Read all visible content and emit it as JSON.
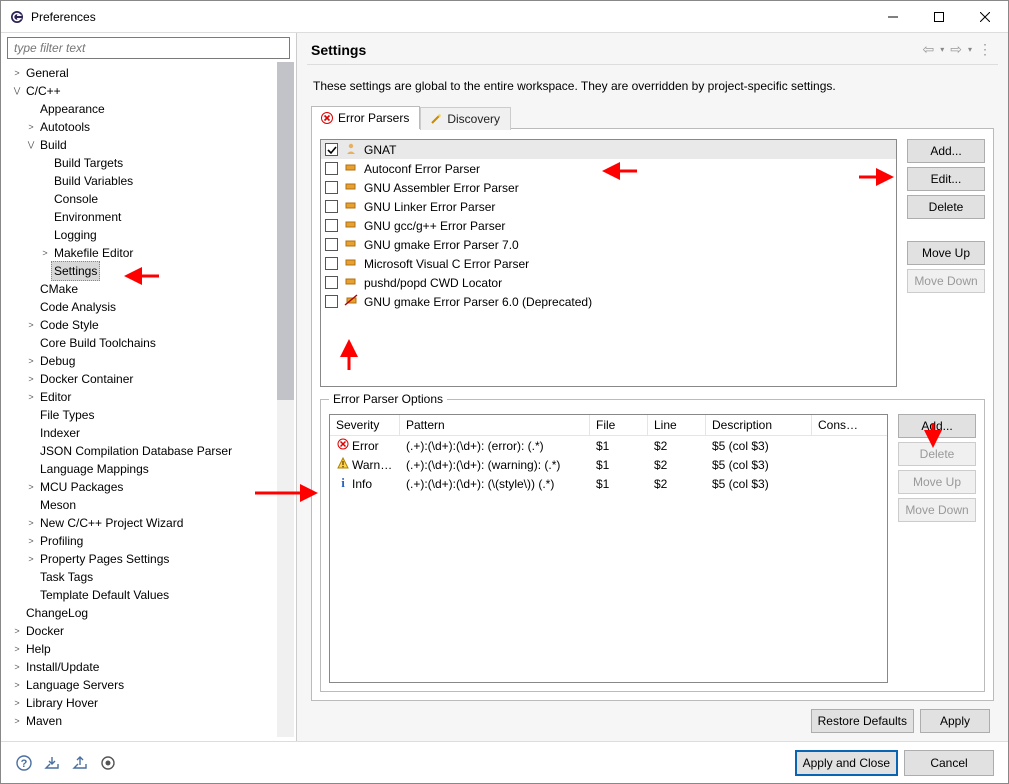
{
  "window": {
    "title": "Preferences"
  },
  "filter": {
    "placeholder": "type filter text"
  },
  "tree": [
    {
      "lvl": 0,
      "tw": ">",
      "label": "General"
    },
    {
      "lvl": 0,
      "tw": "v",
      "label": "C/C++"
    },
    {
      "lvl": 1,
      "tw": "",
      "label": "Appearance"
    },
    {
      "lvl": 1,
      "tw": ">",
      "label": "Autotools"
    },
    {
      "lvl": 1,
      "tw": "v",
      "label": "Build"
    },
    {
      "lvl": 2,
      "tw": "",
      "label": "Build Targets"
    },
    {
      "lvl": 2,
      "tw": "",
      "label": "Build Variables"
    },
    {
      "lvl": 2,
      "tw": "",
      "label": "Console"
    },
    {
      "lvl": 2,
      "tw": "",
      "label": "Environment"
    },
    {
      "lvl": 2,
      "tw": "",
      "label": "Logging"
    },
    {
      "lvl": 2,
      "tw": ">",
      "label": "Makefile Editor"
    },
    {
      "lvl": 2,
      "tw": "",
      "label": "Settings",
      "selected": true
    },
    {
      "lvl": 1,
      "tw": "",
      "label": "CMake"
    },
    {
      "lvl": 1,
      "tw": "",
      "label": "Code Analysis"
    },
    {
      "lvl": 1,
      "tw": ">",
      "label": "Code Style"
    },
    {
      "lvl": 1,
      "tw": "",
      "label": "Core Build Toolchains"
    },
    {
      "lvl": 1,
      "tw": ">",
      "label": "Debug"
    },
    {
      "lvl": 1,
      "tw": ">",
      "label": "Docker Container"
    },
    {
      "lvl": 1,
      "tw": ">",
      "label": "Editor"
    },
    {
      "lvl": 1,
      "tw": "",
      "label": "File Types"
    },
    {
      "lvl": 1,
      "tw": "",
      "label": "Indexer"
    },
    {
      "lvl": 1,
      "tw": "",
      "label": "JSON Compilation Database Parser"
    },
    {
      "lvl": 1,
      "tw": "",
      "label": "Language Mappings"
    },
    {
      "lvl": 1,
      "tw": ">",
      "label": "MCU Packages"
    },
    {
      "lvl": 1,
      "tw": "",
      "label": "Meson"
    },
    {
      "lvl": 1,
      "tw": ">",
      "label": "New C/C++ Project Wizard"
    },
    {
      "lvl": 1,
      "tw": ">",
      "label": "Profiling"
    },
    {
      "lvl": 1,
      "tw": ">",
      "label": "Property Pages Settings"
    },
    {
      "lvl": 1,
      "tw": "",
      "label": "Task Tags"
    },
    {
      "lvl": 1,
      "tw": "",
      "label": "Template Default Values"
    },
    {
      "lvl": 0,
      "tw": "",
      "label": "ChangeLog"
    },
    {
      "lvl": 0,
      "tw": ">",
      "label": "Docker"
    },
    {
      "lvl": 0,
      "tw": ">",
      "label": "Help"
    },
    {
      "lvl": 0,
      "tw": ">",
      "label": "Install/Update"
    },
    {
      "lvl": 0,
      "tw": ">",
      "label": "Language Servers"
    },
    {
      "lvl": 0,
      "tw": ">",
      "label": "Library Hover"
    },
    {
      "lvl": 0,
      "tw": ">",
      "label": "Maven"
    }
  ],
  "page": {
    "heading": "Settings",
    "description": "These settings are global to the entire workspace.  They are overridden by project-specific settings.",
    "tab1": "Error Parsers",
    "tab2": "Discovery"
  },
  "parsers": [
    {
      "checked": true,
      "icon": "person",
      "label": "GNAT",
      "sel": true
    },
    {
      "checked": false,
      "icon": "brick",
      "label": "Autoconf Error Parser"
    },
    {
      "checked": false,
      "icon": "brick",
      "label": "GNU Assembler Error Parser"
    },
    {
      "checked": false,
      "icon": "brick",
      "label": "GNU Linker Error Parser"
    },
    {
      "checked": false,
      "icon": "brick",
      "label": "GNU gcc/g++ Error Parser"
    },
    {
      "checked": false,
      "icon": "brick",
      "label": "GNU gmake Error Parser 7.0"
    },
    {
      "checked": false,
      "icon": "brick",
      "label": "Microsoft Visual C Error Parser"
    },
    {
      "checked": false,
      "icon": "brick",
      "label": "pushd/popd CWD Locator"
    },
    {
      "checked": false,
      "icon": "brick-dep",
      "label": "GNU gmake Error Parser 6.0 (Deprecated)"
    }
  ],
  "parserButtons": {
    "add": "Add...",
    "edit": "Edit...",
    "delete": "Delete",
    "moveUp": "Move Up",
    "moveDown": "Move Down"
  },
  "optionsGroup": "Error Parser Options",
  "tableHeaders": {
    "sev": "Severity",
    "pat": "Pattern",
    "file": "File",
    "line": "Line",
    "desc": "Description",
    "cons": "Consu..."
  },
  "patterns": [
    {
      "sev": "Error",
      "icon": "err",
      "pat": "(.+):(\\d+):(\\d+): (error): (.*)",
      "file": "$1",
      "line": "$2",
      "desc": "$5 (col $3)"
    },
    {
      "sev": "Warning",
      "icon": "warn",
      "pat": "(.+):(\\d+):(\\d+): (warning): (.*)",
      "file": "$1",
      "line": "$2",
      "desc": "$5 (col $3)"
    },
    {
      "sev": "Info",
      "icon": "info",
      "pat": "(.+):(\\d+):(\\d+): (\\(style\\)) (.*)",
      "file": "$1",
      "line": "$2",
      "desc": "$5 (col $3)"
    }
  ],
  "optionButtons": {
    "add": "Add...",
    "delete": "Delete",
    "moveUp": "Move Up",
    "moveDown": "Move Down"
  },
  "bottom": {
    "restore": "Restore Defaults",
    "apply": "Apply"
  },
  "footer": {
    "applyClose": "Apply and Close",
    "cancel": "Cancel"
  }
}
